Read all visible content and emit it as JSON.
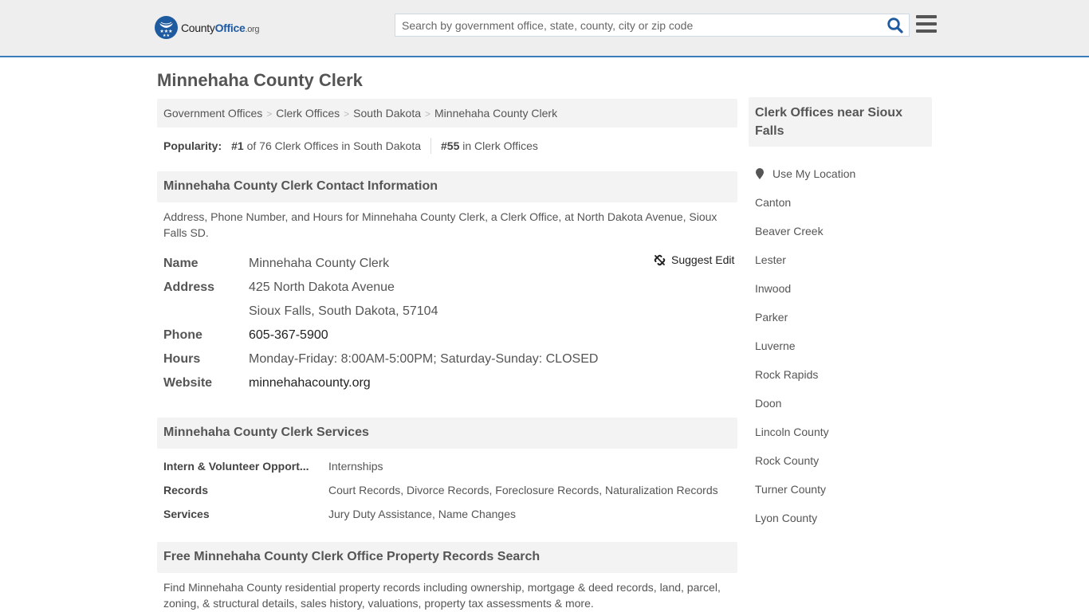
{
  "header": {
    "logo": {
      "brand_part1": "County",
      "brand_part2": "Office",
      "brand_tld": ".org"
    },
    "search": {
      "placeholder": "Search by government office, state, county, city or zip code",
      "value": ""
    },
    "search_icon": "search-icon",
    "menu_icon": "hamburger-menu-icon",
    "colors": {
      "brand_blue": "#1e5aa0",
      "header_bg": "#eeeeee",
      "header_border": "#3a7dba"
    }
  },
  "page": {
    "title": "Minnehaha County Clerk"
  },
  "breadcrumb": [
    {
      "label": "Government Offices"
    },
    {
      "label": "Clerk Offices"
    },
    {
      "label": "South Dakota"
    },
    {
      "label": "Minnehaha County Clerk"
    }
  ],
  "breadcrumb_separator": ">",
  "popularity": {
    "label": "Popularity:",
    "state_rank": "#1",
    "state_text": "of 76 Clerk Offices in South Dakota",
    "national_rank": "#55",
    "national_text": "in Clerk Offices"
  },
  "contact": {
    "heading": "Minnehaha County Clerk Contact Information",
    "description": "Address, Phone Number, and Hours for Minnehaha County Clerk, a Clerk Office, at North Dakota Avenue, Sioux Falls SD.",
    "suggest_edit": "Suggest Edit",
    "rows": {
      "name": {
        "label": "Name",
        "value": "Minnehaha County Clerk"
      },
      "address": {
        "label": "Address",
        "line1": "425 North Dakota Avenue",
        "line2": "Sioux Falls, South Dakota, 57104"
      },
      "phone": {
        "label": "Phone",
        "value": "605-367-5900"
      },
      "hours": {
        "label": "Hours",
        "value": "Monday-Friday: 8:00AM-5:00PM; Saturday-Sunday: CLOSED"
      },
      "website": {
        "label": "Website",
        "value": "minnehahacounty.org"
      }
    }
  },
  "services": {
    "heading": "Minnehaha County Clerk Services",
    "rows": [
      {
        "label": "Intern & Volunteer Opport...",
        "value": "Internships"
      },
      {
        "label": "Records",
        "value": "Court Records, Divorce Records, Foreclosure Records, Naturalization Records"
      },
      {
        "label": "Services",
        "value": "Jury Duty Assistance, Name Changes"
      }
    ]
  },
  "property": {
    "heading": "Free Minnehaha County Clerk Office Property Records Search",
    "description": "Find Minnehaha County residential property records including ownership, mortgage & deed records, land, parcel, zoning, & structural details, sales history, valuations, property tax assessments & more."
  },
  "sidebar": {
    "heading": "Clerk Offices near Sioux Falls",
    "use_location": "Use My Location",
    "links": [
      "Canton",
      "Beaver Creek",
      "Lester",
      "Inwood",
      "Parker",
      "Luverne",
      "Rock Rapids",
      "Doon",
      "Lincoln County",
      "Rock County",
      "Turner County",
      "Lyon County"
    ]
  }
}
